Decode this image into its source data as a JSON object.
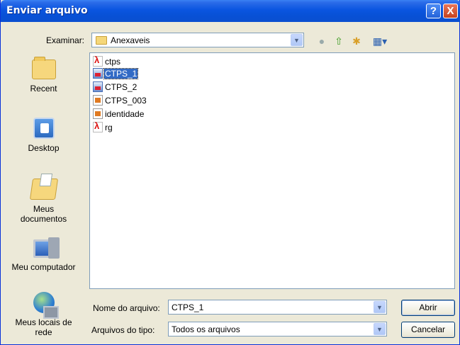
{
  "window": {
    "title": "Enviar arquivo"
  },
  "toolbar": {
    "look_in_label": "Examinar:",
    "look_in_value": "Anexaveis"
  },
  "places": [
    {
      "label": "Recent",
      "icon": "recent-folder-icon"
    },
    {
      "label": "Desktop",
      "icon": "desktop-icon"
    },
    {
      "label": "Meus documentos",
      "icon": "my-documents-icon"
    },
    {
      "label": "Meu computador",
      "icon": "my-computer-icon"
    },
    {
      "label": "Meus locais de rede",
      "icon": "network-places-icon"
    }
  ],
  "files": [
    {
      "name": "ctps",
      "type": "pdf",
      "selected": false
    },
    {
      "name": "CTPS_1",
      "type": "image",
      "selected": true
    },
    {
      "name": "CTPS_2",
      "type": "image",
      "selected": false
    },
    {
      "name": "CTPS_003",
      "type": "document",
      "selected": false
    },
    {
      "name": "identidade",
      "type": "document",
      "selected": false
    },
    {
      "name": "rg",
      "type": "pdf",
      "selected": false
    }
  ],
  "filename": {
    "label": "Nome do arquivo:",
    "value": "CTPS_1"
  },
  "filetype": {
    "label": "Arquivos do tipo:",
    "value": "Todos os arquivos"
  },
  "buttons": {
    "open": "Abrir",
    "cancel": "Cancelar",
    "help": "?",
    "close": "X"
  },
  "colors": {
    "titlebar": "#0a55e0",
    "selection": "#316ac5",
    "dialog_bg": "#ece9d8"
  }
}
